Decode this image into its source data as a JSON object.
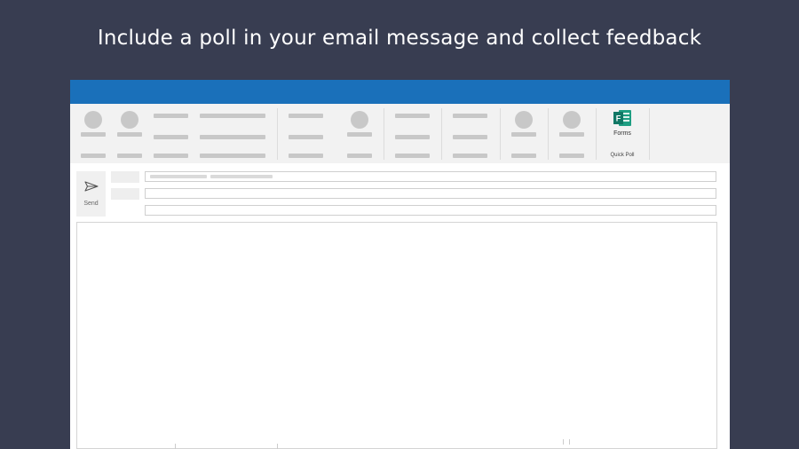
{
  "headline": "Include a poll in your email message and collect feedback",
  "ribbon": {
    "forms_label": "Forms",
    "group_label": "Quick Poll",
    "forms_icon_letter": "F",
    "icon": "forms-icon"
  },
  "compose": {
    "send_label": "Send",
    "send_icon": "send-icon"
  },
  "colors": {
    "background": "#383d51",
    "titlebar": "#1a70ba",
    "ribbon": "#f2f2f2",
    "forms_green": "#117865"
  }
}
